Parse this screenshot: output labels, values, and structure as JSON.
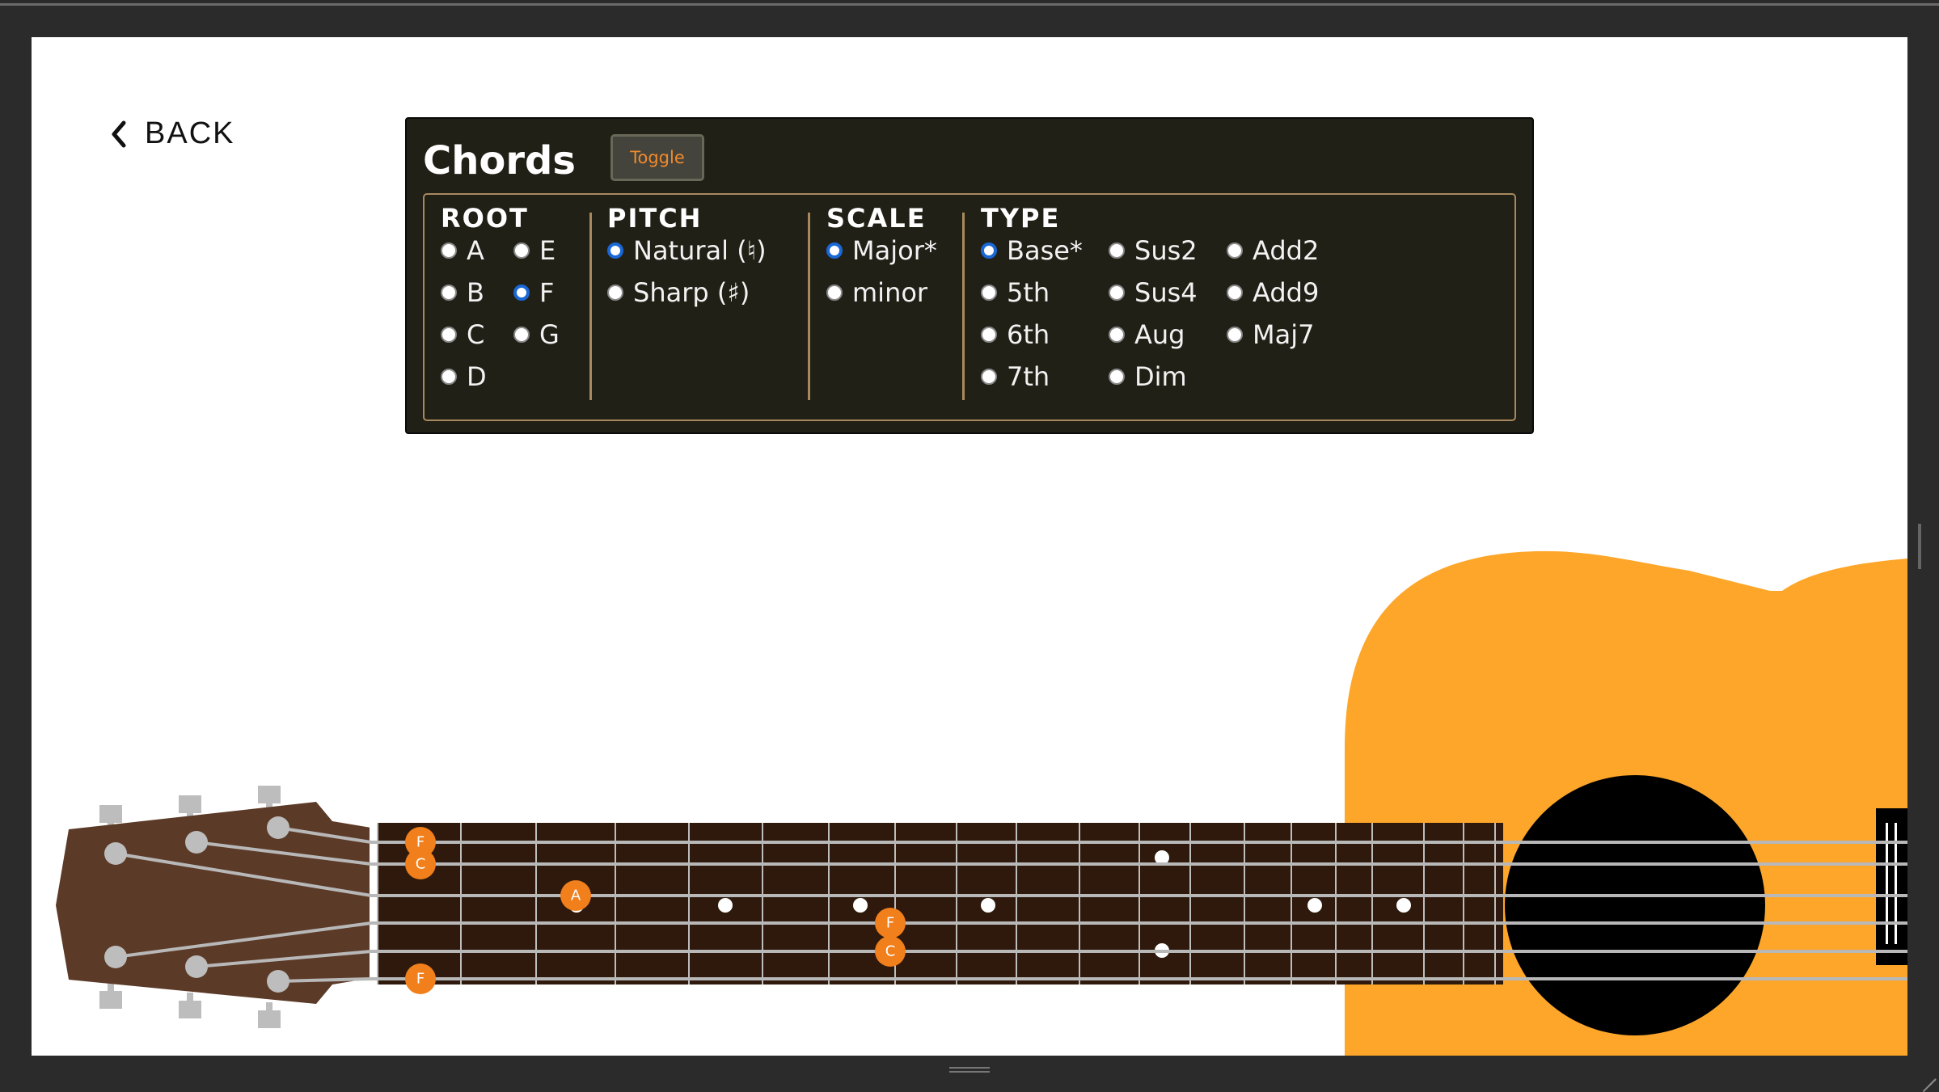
{
  "nav": {
    "back_label": "BACK"
  },
  "panel": {
    "title": "Chords",
    "toggle_label": "Toggle",
    "root": {
      "heading": "ROOT",
      "options": [
        {
          "label": "A",
          "selected": false
        },
        {
          "label": "E",
          "selected": false
        },
        {
          "label": "B",
          "selected": false
        },
        {
          "label": "F",
          "selected": true
        },
        {
          "label": "C",
          "selected": false
        },
        {
          "label": "G",
          "selected": false
        },
        {
          "label": "D",
          "selected": false
        }
      ]
    },
    "pitch": {
      "heading": "PITCH",
      "options": [
        {
          "label": "Natural (♮)",
          "selected": true
        },
        {
          "label": "Sharp (♯)",
          "selected": false
        }
      ]
    },
    "scale": {
      "heading": "SCALE",
      "options": [
        {
          "label": "Major*",
          "selected": true
        },
        {
          "label": "minor",
          "selected": false
        }
      ]
    },
    "type": {
      "heading": "TYPE",
      "options": [
        {
          "label": "Base*",
          "selected": true
        },
        {
          "label": "Sus2",
          "selected": false
        },
        {
          "label": "Add2",
          "selected": false
        },
        {
          "label": "5th",
          "selected": false
        },
        {
          "label": "Sus4",
          "selected": false
        },
        {
          "label": "Add9",
          "selected": false
        },
        {
          "label": "6th",
          "selected": false
        },
        {
          "label": "Aug",
          "selected": false
        },
        {
          "label": "Maj7",
          "selected": false
        },
        {
          "label": "7th",
          "selected": false
        },
        {
          "label": "Dim",
          "selected": false
        }
      ]
    }
  },
  "fretboard": {
    "notes": [
      {
        "label": "F",
        "string": 1,
        "fret": 0
      },
      {
        "label": "C",
        "string": 2,
        "fret": 0
      },
      {
        "label": "A",
        "string": 3,
        "fret": 1
      },
      {
        "label": "F",
        "string": 4,
        "fret": 3
      },
      {
        "label": "C",
        "string": 5,
        "fret": 3
      },
      {
        "label": "F",
        "string": 6,
        "fret": 0
      }
    ]
  },
  "colors": {
    "accent": "#f08a2c",
    "note_marker": "#f07f1c",
    "guitar_body": "#fda62a",
    "headstock": "#5c3a28",
    "fretboard": "#2e190c",
    "panel_bg": "#212016",
    "panel_border": "#a8895f",
    "radio_selected": "#1a68d6"
  }
}
